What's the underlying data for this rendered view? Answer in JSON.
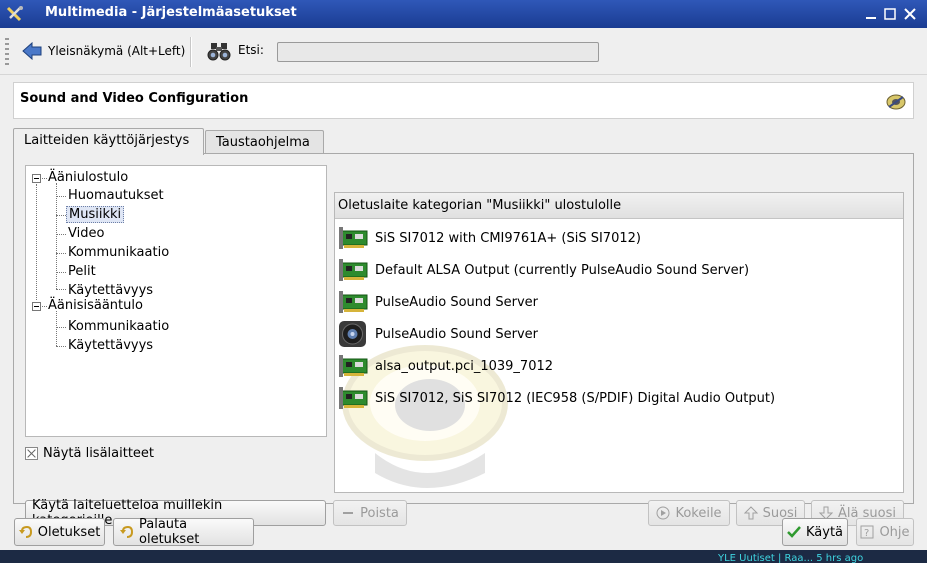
{
  "window": {
    "title": "Multimedia - Järjestelmäasetukset"
  },
  "toolbar": {
    "back_label": "Yleisnäkymä (Alt+Left)",
    "search_label": "Etsi:",
    "search_value": ""
  },
  "header": {
    "title": "Sound and Video Configuration"
  },
  "tabs": [
    {
      "label": "Laitteiden käyttöjärjestys",
      "active": true
    },
    {
      "label": "Taustaohjelma",
      "active": false
    }
  ],
  "tree": {
    "groups": [
      {
        "label": "Ääniulostulo",
        "children": [
          "Huomautukset",
          "Musiikki",
          "Video",
          "Kommunikaatio",
          "Pelit",
          "Käytettävyys"
        ]
      },
      {
        "label": "Äänisisääntulo",
        "children": [
          "Kommunikaatio",
          "Käytettävyys"
        ]
      }
    ],
    "selected": "Musiikki"
  },
  "show_extra": {
    "label": "Näytä lisälaitteet",
    "checked": true
  },
  "devices": {
    "header": "Oletuslaite kategorian \"Musiikki\" ulostulolle",
    "items": [
      {
        "label": "SiS SI7012 with CMI9761A+ (SiS SI7012)",
        "icon": "sound-card-icon"
      },
      {
        "label": "Default ALSA Output (currently PulseAudio Sound Server)",
        "icon": "sound-card-icon"
      },
      {
        "label": "PulseAudio Sound Server",
        "icon": "sound-card-icon"
      },
      {
        "label": "PulseAudio Sound Server",
        "icon": "speaker-icon"
      },
      {
        "label": "alsa_output.pci_1039_7012",
        "icon": "sound-card-icon"
      },
      {
        "label": "SiS SI7012, SiS SI7012 (IEC958 (S/PDIF) Digital Audio Output)",
        "icon": "sound-card-icon"
      }
    ]
  },
  "buttons": {
    "apply_list": "Käytä laiteluetteloa muillekin kategorioille...",
    "remove": "Poista",
    "test": "Kokeile",
    "prefer": "Suosi",
    "defer": "Älä suosi",
    "defaults": "Oletukset",
    "reset": "Palauta oletukset",
    "apply": "Käytä",
    "help": "Ohje"
  },
  "taskbar": {
    "tray_text": "YLE Uutiset | Raa... 5 hrs ago"
  },
  "colors": {
    "titlebar": "#2a50ab",
    "selection": "#dfe6f5",
    "card_green": "#2e8b2e"
  }
}
